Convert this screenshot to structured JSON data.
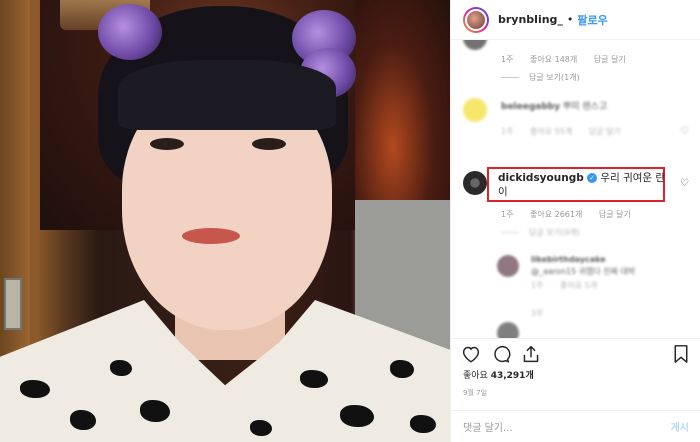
{
  "post": {
    "username": "brynbling_",
    "dot": "•",
    "follow_label": "팔로우"
  },
  "comments": {
    "top_reply": {
      "time": "1주",
      "likes": "좋아요 148개",
      "reply": "답글 달기",
      "view_replies": "답글 보기(1개)"
    },
    "blurred_1": {
      "username": "beleegabby",
      "text": "뿌띠 렌스고",
      "time": "1주",
      "likes": "좋아요 55개",
      "reply": "답글 달기"
    },
    "highlighted": {
      "username": "dickidsyoungb",
      "verified_mark": "✓",
      "text_line1": "우리 귀여운 란",
      "text_line2": "이",
      "time": "1주",
      "likes": "좋아요 2661개",
      "reply": "답글 달기",
      "view_replies": "답글 보기(9개)"
    },
    "blurred_2": {
      "username": "likebirthdaycake",
      "text": "@_aaron15 귀엽다 진짜 대박",
      "time": "1주",
      "likes": "좋아요 5개"
    },
    "blurred_3": {
      "time": "3주"
    }
  },
  "actions": {
    "like_icon": "heart-icon",
    "comment_icon": "comment-icon",
    "share_icon": "share-icon",
    "save_icon": "bookmark-icon"
  },
  "likes": {
    "prefix": "좋아요",
    "count": "43,291개"
  },
  "date": "9월 7일",
  "add_comment": {
    "placeholder": "댓글 달기...",
    "post_label": "게시"
  },
  "colors": {
    "link": "#3897f0",
    "highlight": "#e0202a"
  }
}
